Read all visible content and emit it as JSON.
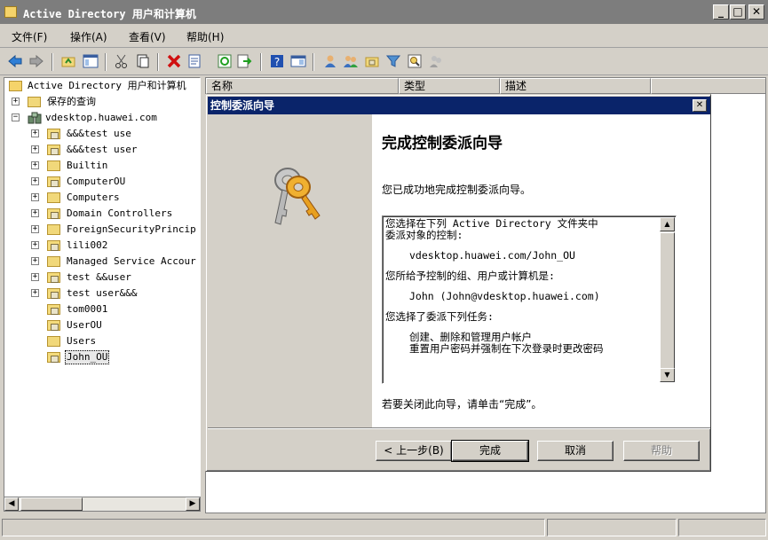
{
  "window": {
    "title": "Active Directory 用户和计算机",
    "controls": {
      "minimize": "_",
      "maximize": "□",
      "close": "✕"
    }
  },
  "menu": [
    {
      "label": "文件(F)"
    },
    {
      "label": "操作(A)"
    },
    {
      "label": "查看(V)"
    },
    {
      "label": "帮助(H)"
    }
  ],
  "tree": {
    "root": "Active Directory 用户和计算机",
    "saved_queries": "保存的查询",
    "domain": "vdesktop.huawei.com",
    "items": [
      {
        "label": "&&&test          use",
        "expandable": true
      },
      {
        "label": "&&&test  user",
        "expandable": true
      },
      {
        "label": "Builtin",
        "expandable": true
      },
      {
        "label": "ComputerOU",
        "expandable": true
      },
      {
        "label": "Computers",
        "expandable": true
      },
      {
        "label": "Domain Controllers",
        "expandable": true
      },
      {
        "label": "ForeignSecurityPrincip",
        "expandable": true
      },
      {
        "label": "lili002",
        "expandable": true
      },
      {
        "label": "Managed Service Accour",
        "expandable": true
      },
      {
        "label": "test  &&user",
        "expandable": true
      },
      {
        "label": "test  user&&&",
        "expandable": true
      },
      {
        "label": "tom0001",
        "expandable": false
      },
      {
        "label": "UserOU",
        "expandable": false
      },
      {
        "label": "Users",
        "expandable": false
      },
      {
        "label": "John_OU",
        "expandable": false,
        "selected": true
      }
    ]
  },
  "list": {
    "columns": [
      "名称",
      "类型",
      "描述"
    ]
  },
  "dialog": {
    "title": "控制委派向导",
    "close": "✕",
    "heading": "完成控制委派向导",
    "success": "您已成功地完成控制委派向导。",
    "summary": {
      "line1": "您选择在下列 Active Directory 文件夹中",
      "line2": "委派对象的控制:",
      "folder": "vdesktop.huawei.com/John_OU",
      "granted_label": "您所给予控制的组、用户或计算机是:",
      "granted_user": "John (John@vdesktop.huawei.com)",
      "tasks_label": "您选择了委派下列任务:",
      "task1": "创建、删除和管理用户帐户",
      "task2": "重置用户密码并强制在下次登录时更改密码"
    },
    "close_hint": "若要关闭此向导，请单击“完成”。",
    "buttons": {
      "back": "< 上一步(B)",
      "finish": "完成",
      "cancel": "取消",
      "help": "帮助"
    }
  },
  "colors": {
    "titlebar_inactive": "#7d7d7d",
    "dialog_titlebar": "#0a246a",
    "face": "#d4d0c8"
  }
}
